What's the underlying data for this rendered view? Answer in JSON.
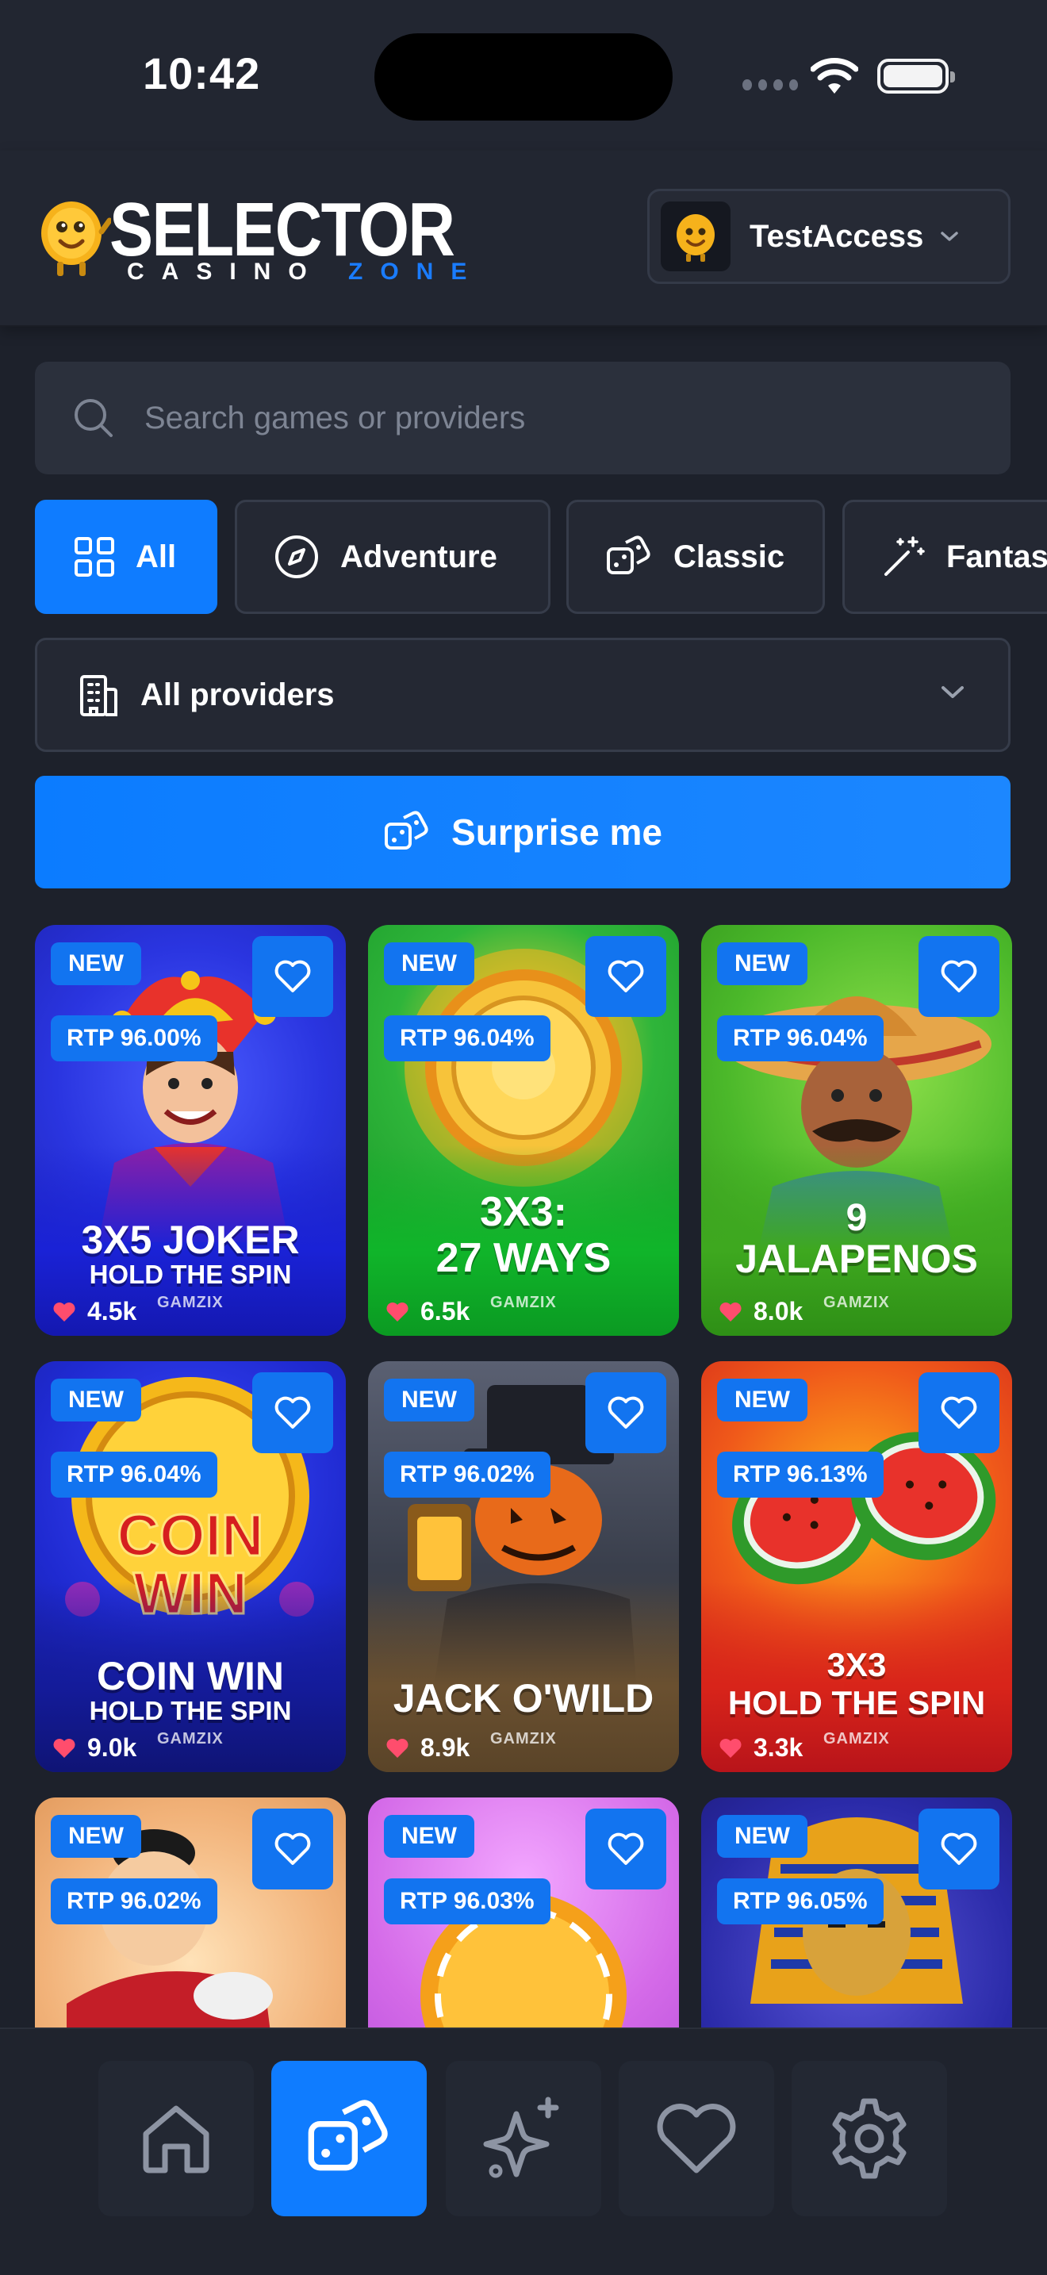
{
  "status_bar": {
    "time": "10:42"
  },
  "header": {
    "logo_word": "SELECTOR",
    "logo_sub_main": "CASINO ",
    "logo_sub_accent": "ZONE",
    "account_name": "TestAccess"
  },
  "search": {
    "placeholder": "Search games or providers"
  },
  "categories": [
    {
      "label": "All",
      "icon": "grid-icon",
      "active": true
    },
    {
      "label": "Adventure",
      "icon": "compass-icon",
      "active": false
    },
    {
      "label": "Classic",
      "icon": "dice-icon",
      "active": false
    },
    {
      "label": "Fantasy",
      "icon": "magic-wand-icon",
      "active": false
    }
  ],
  "providers": {
    "label": "All providers"
  },
  "surprise": {
    "label": "Surprise me"
  },
  "games": [
    {
      "badge": "NEW",
      "rtp": "RTP 96.00%",
      "title_1": "3X5 JOKER",
      "title_2": "HOLD THE SPIN",
      "likes": "4.5k",
      "provider": "GAMZIX"
    },
    {
      "badge": "NEW",
      "rtp": "RTP 96.04%",
      "title_1": "3X3:",
      "title_2": "27 WAYS",
      "likes": "6.5k",
      "provider": "GAMZIX"
    },
    {
      "badge": "NEW",
      "rtp": "RTP 96.04%",
      "title_1": "9",
      "title_2": "JALAPENOS",
      "likes": "8.0k",
      "provider": "GAMZIX"
    },
    {
      "badge": "NEW",
      "rtp": "RTP 96.04%",
      "title_1": "COIN WIN",
      "title_2": "HOLD THE SPIN",
      "likes": "9.0k",
      "provider": "GAMZIX"
    },
    {
      "badge": "NEW",
      "rtp": "RTP 96.02%",
      "title_1": "JACK O'WILD",
      "title_2": "",
      "likes": "8.9k",
      "provider": "GAMZIX"
    },
    {
      "badge": "NEW",
      "rtp": "RTP 96.13%",
      "title_1": "3X3",
      "title_2": "HOLD THE SPIN",
      "likes": "3.3k",
      "provider": "GAMZIX"
    },
    {
      "badge": "NEW",
      "rtp": "RTP 96.02%"
    },
    {
      "badge": "NEW",
      "rtp": "RTP 96.03%"
    },
    {
      "badge": "NEW",
      "rtp": "RTP 96.05%"
    }
  ],
  "bottom_nav": [
    {
      "icon": "home-icon",
      "active": false
    },
    {
      "icon": "dice-icon",
      "active": true
    },
    {
      "icon": "sparkle-icon",
      "active": false
    },
    {
      "icon": "heart-icon",
      "active": false
    },
    {
      "icon": "gear-icon",
      "active": false
    }
  ],
  "colors": {
    "accent": "#0f7cff",
    "background": "#1d212b",
    "surface": "#2b303c",
    "like": "#ff4d6d"
  }
}
